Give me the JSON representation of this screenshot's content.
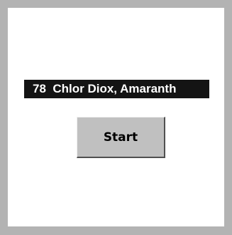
{
  "title_bar": {
    "text": "78  Chlor Diox, Amaranth"
  },
  "start_button": {
    "label": "Start"
  },
  "colors": {
    "frame": "#b3b3b3",
    "panel": "#ffffff",
    "title_bar_background": "#141414",
    "title_bar_text": "#ffffff",
    "button_face": "#c0c0c0"
  }
}
